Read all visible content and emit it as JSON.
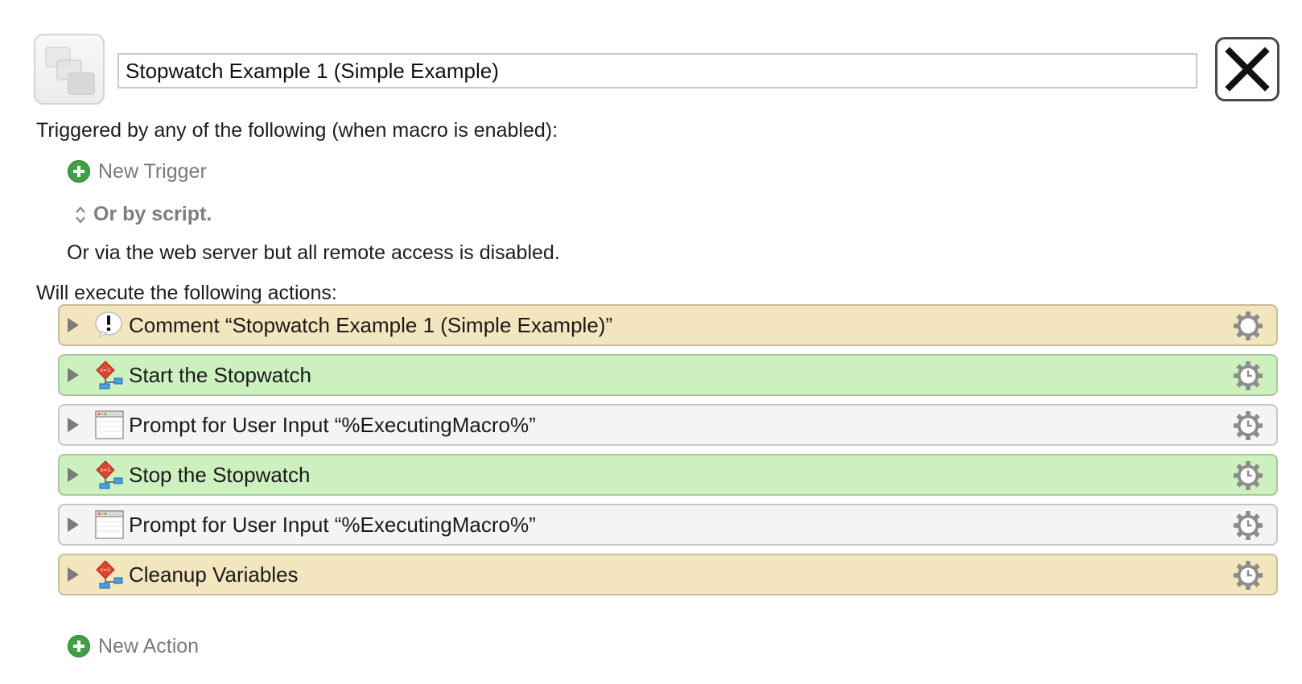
{
  "macro": {
    "icon": "macro-group-icon",
    "title": "Stopwatch Example 1 (Simple Example)"
  },
  "close_icon": "close-x-icon",
  "triggers": {
    "heading": "Triggered by any of the following (when macro is enabled):",
    "new_trigger_label": "New Trigger",
    "or_by_script_label": "Or by script.",
    "web_server_text": "Or via the web server but all remote access is disabled."
  },
  "actions": {
    "heading": "Will execute the following actions:",
    "items": [
      {
        "label": "Comment “Stopwatch Example 1 (Simple Example)”",
        "icon": "comment-icon",
        "color": "#f3e5bd",
        "gear": "gear-icon"
      },
      {
        "label": "Start the Stopwatch",
        "icon": "set-variable-icon",
        "color": "#cdf0bf",
        "gear": "gear-clock-icon"
      },
      {
        "label": "Prompt for User Input “%ExecutingMacro%”",
        "icon": "window-icon",
        "color": "#f4f4f4",
        "gear": "gear-clock-icon"
      },
      {
        "label": "Stop the Stopwatch",
        "icon": "set-variable-icon",
        "color": "#cdf0bf",
        "gear": "gear-clock-icon"
      },
      {
        "label": "Prompt for User Input “%ExecutingMacro%”",
        "icon": "window-icon",
        "color": "#f4f4f4",
        "gear": "gear-clock-icon"
      },
      {
        "label": "Cleanup Variables",
        "icon": "set-variable-icon",
        "color": "#f3e5bd",
        "gear": "gear-clock-icon"
      }
    ],
    "new_action_label": "New Action"
  },
  "colors": {
    "add_green": "#3fa044",
    "comment_tan": "#f3e5bd",
    "action_green": "#cdf0bf",
    "action_gray": "#f4f4f4"
  }
}
